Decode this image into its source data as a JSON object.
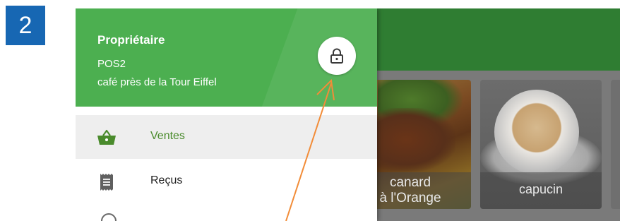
{
  "step": {
    "number": "2"
  },
  "drawer": {
    "header": {
      "role": "Propriétaire",
      "pos": "POS2",
      "location": "café près de la Tour Eiffel",
      "lock_icon": "lock-icon"
    },
    "items": [
      {
        "label": "Ventes",
        "icon": "basket-icon",
        "active": true
      },
      {
        "label": "Reçus",
        "icon": "receipt-icon",
        "active": false
      }
    ]
  },
  "grid": {
    "tiles": [
      {
        "line1": "canard",
        "line2": "à l'Orange"
      },
      {
        "line1": "capucin"
      }
    ]
  },
  "colors": {
    "badge": "#1767b3",
    "drawer_header": "#4caf50",
    "app_bar": "#2f7d32",
    "active_label": "#4a8b2c",
    "arrow": "#f28c38"
  }
}
